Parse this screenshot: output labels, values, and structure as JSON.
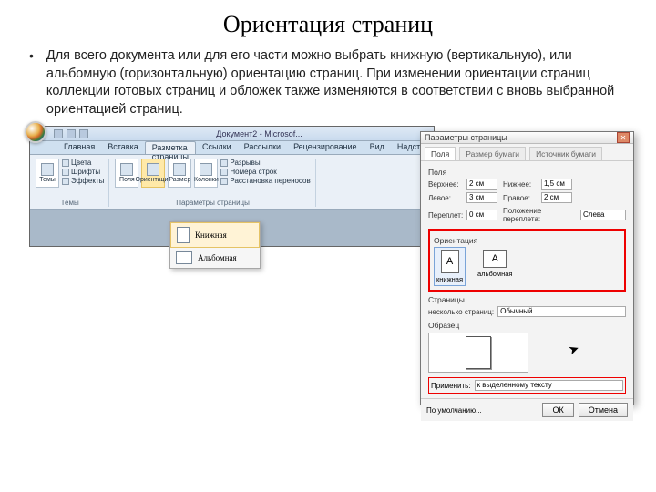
{
  "title": "Ориентация страниц",
  "paragraph": "Для всего документа или для его части можно выбрать книжную (вертикальную), или альбомную (горизонтальную) ориентацию страниц. При изменении ориентации страниц коллекции готовых страниц и обложек также изменяются в соответствии с вновь выбранной ориентацией страниц.",
  "word": {
    "doc_title": "Документ2 - Microsof...",
    "tabs": [
      "Главная",
      "Вставка",
      "Разметка страницы",
      "Ссылки",
      "Рассылки",
      "Рецензирование",
      "Вид",
      "Надстройки"
    ],
    "active_tab_index": 2,
    "theme_group": {
      "label": "Темы",
      "big": "Темы",
      "items": [
        "Цвета",
        "Шрифты",
        "Эффекты"
      ]
    },
    "pagesetup_group": {
      "label": "Параметры страницы",
      "buttons": [
        "Поля",
        "Ориентация",
        "Размер",
        "Колонки"
      ],
      "side_items": [
        "Разрывы",
        "Номера строк",
        "Расстановка переносов"
      ]
    },
    "dropdown": {
      "portrait": "Книжная",
      "landscape": "Альбомная"
    }
  },
  "dialog": {
    "title": "Параметры страницы",
    "tabs": [
      "Поля",
      "Размер бумаги",
      "Источник бумаги"
    ],
    "margins": {
      "section": "Поля",
      "top_l": "Верхнее:",
      "top_v": "2 см",
      "bottom_l": "Нижнее:",
      "bottom_v": "1,5 см",
      "left_l": "Левое:",
      "left_v": "3 см",
      "right_l": "Правое:",
      "right_v": "2 см",
      "gutter_l": "Переплет:",
      "gutter_v": "0 см",
      "gutpos_l": "Положение переплета:",
      "gutpos_v": "Слева"
    },
    "orientation": {
      "section": "Ориентация",
      "portrait": "книжная",
      "landscape": "альбомная"
    },
    "pages": {
      "section": "Страницы",
      "label": "несколько страниц:",
      "value": "Обычный"
    },
    "preview": {
      "section": "Образец"
    },
    "apply": {
      "label": "Применить:",
      "value": "к выделенному тексту"
    },
    "footer": {
      "default": "По умолчанию...",
      "ok": "ОК",
      "cancel": "Отмена"
    }
  }
}
